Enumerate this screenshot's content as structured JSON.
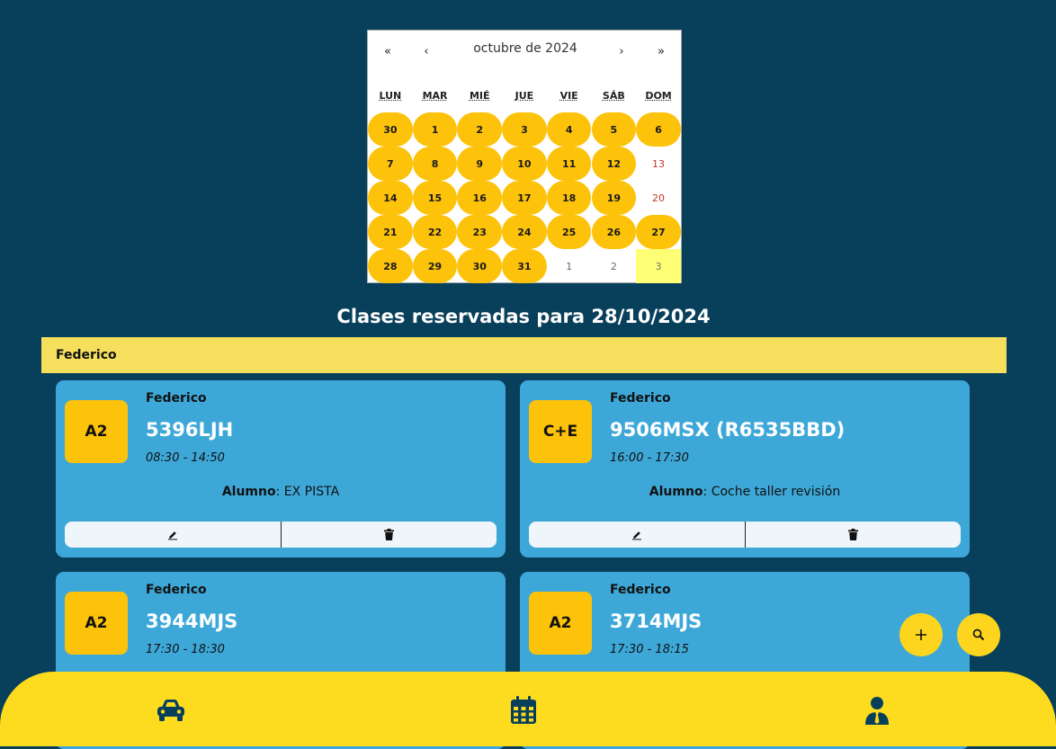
{
  "calendar": {
    "nav": {
      "prev_year": "«",
      "prev_month": "‹",
      "label": "octubre de 2024",
      "next_month": "›",
      "next_year": "»"
    },
    "weekdays": [
      "LUN",
      "MAR",
      "MIÉ",
      "JUE",
      "VIE",
      "SÁB",
      "DOM"
    ],
    "weeks": [
      [
        "30",
        "1",
        "2",
        "3",
        "4",
        "5",
        "6"
      ],
      [
        "7",
        "8",
        "9",
        "10",
        "11",
        "12",
        "13"
      ],
      [
        "14",
        "15",
        "16",
        "17",
        "18",
        "19",
        "20"
      ],
      [
        "21",
        "22",
        "23",
        "24",
        "25",
        "26",
        "27"
      ],
      [
        "28",
        "29",
        "30",
        "31",
        "1",
        "2",
        "3"
      ]
    ]
  },
  "page_title": "Clases reservadas para 28/10/2024",
  "instructor_header": "Federico",
  "student_label": "Alumno",
  "cards": [
    {
      "license": "A2",
      "instructor": "Federico",
      "plate": "5396LJH",
      "time": "08:30 - 14:50",
      "student": "EX PISTA"
    },
    {
      "license": "C+E",
      "instructor": "Federico",
      "plate": "9506MSX (R6535BBD)",
      "time": "16:00 - 17:30",
      "student": "Coche taller revisión"
    },
    {
      "license": "A2",
      "instructor": "Federico",
      "plate": "3944MJS",
      "time": "17:30 - 18:30",
      "student": ""
    },
    {
      "license": "A2",
      "instructor": "Federico",
      "plate": "3714MJS",
      "time": "17:30 - 18:15",
      "student": ""
    }
  ],
  "icons": {
    "edit": "pencil-icon",
    "delete": "trash-icon",
    "add": "plus-icon",
    "search": "search-icon",
    "nav_vehicles": "car-icon",
    "nav_calendar": "calendar-icon",
    "nav_profile": "user-tie-icon"
  },
  "colors": {
    "background": "#08405c",
    "accent": "#fdc20a",
    "card": "#3da8d8",
    "nav": "#fddb1f",
    "sunday": "#c0392b",
    "today": "#ffff76"
  }
}
